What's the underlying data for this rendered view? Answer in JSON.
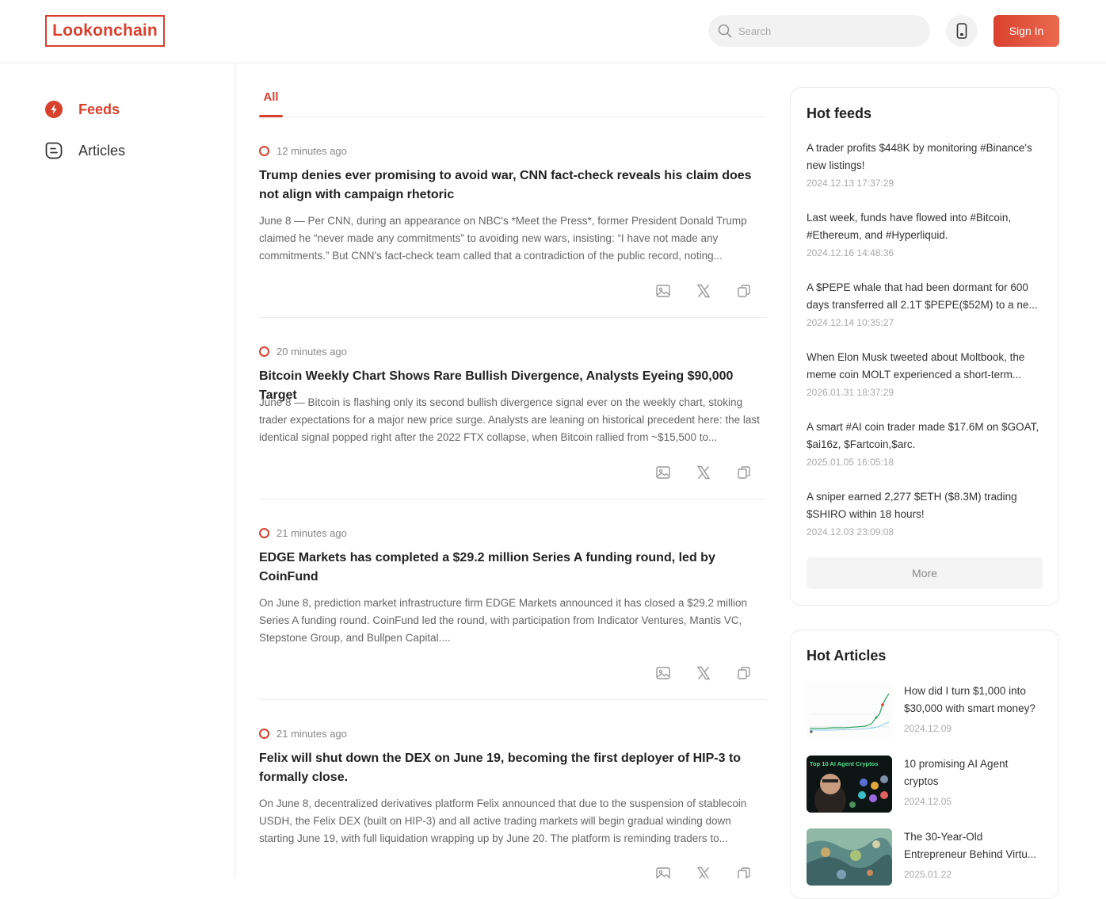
{
  "header": {
    "logo": "Lookonchain",
    "search_placeholder": "Search",
    "sign_in": "Sign In",
    "accent": "#d9412e"
  },
  "sidebar": {
    "items": [
      {
        "label": "Feeds",
        "icon": "lightning-icon",
        "active": true
      },
      {
        "label": "Articles",
        "icon": "article-icon",
        "active": false
      }
    ]
  },
  "main": {
    "tabs": [
      {
        "label": "All",
        "active": true
      }
    ],
    "feeds": [
      {
        "time": "12 minutes ago",
        "title": "Trump denies ever promising to avoid war, CNN fact-check reveals his claim does not align with campaign rhetoric",
        "body": "June 8 — Per CNN, during an appearance on NBC's *Meet the Press*, former President Donald Trump claimed he “never made any commitments” to avoiding new wars, insisting: “I have not made any commitments.” But CNN's fact-check team called that a contradiction of the public record, noting..."
      },
      {
        "time": "20 minutes ago",
        "title": "Bitcoin Weekly Chart Shows Rare Bullish Divergence, Analysts Eyeing $90,000 Target",
        "body": "June 8 — Bitcoin is flashing only its second bullish divergence signal ever on the weekly chart, stoking trader expectations for a major new price surge. Analysts are leaning on historical precedent here: the last identical signal popped right after the 2022 FTX collapse, when Bitcoin rallied from ~$15,500 to..."
      },
      {
        "time": "21 minutes ago",
        "title": "EDGE Markets has completed a $29.2 million Series A funding round, led by CoinFund",
        "body": "On June 8, prediction market infrastructure firm EDGE Markets announced it has closed a $29.2 million Series A funding round. CoinFund led the round, with participation from Indicator Ventures, Mantis VC, Stepstone Group, and Bullpen Capital...."
      },
      {
        "time": "21 minutes ago",
        "title": "Felix will shut down the DEX on June 19, becoming the first deployer of HIP-3 to formally close.",
        "body": "On June 8, decentralized derivatives platform Felix announced that due to the suspension of stablecoin USDH, the Felix DEX (built on HIP-3) and all active trading markets will begin gradual winding down starting June 19, with full liquidation wrapping up by June 20. The platform is reminding traders to..."
      }
    ]
  },
  "hot_feeds": {
    "title": "Hot feeds",
    "more": "More",
    "items": [
      {
        "text": "A trader profits $448K by monitoring #Binance's new listings!",
        "date": "2024.12.13 17:37:29"
      },
      {
        "text": "Last week, funds have flowed into #Bitcoin, #Ethereum, and #Hyperliquid.",
        "date": "2024.12.16 14:48:36"
      },
      {
        "text": "A $PEPE whale that had been dormant for 600 days transferred all 2.1T $PEPE($52M) to a ne...",
        "date": "2024.12.14 10:35:27"
      },
      {
        "text": "When Elon Musk tweeted about Moltbook, the meme coin MOLT experienced a short-term...",
        "date": "2026.01.31 18:37:29"
      },
      {
        "text": "A smart #AI coin trader made $17.6M on $GOAT, $ai16z, $Fartcoin,$arc.",
        "date": "2025.01.05 16:05:18"
      },
      {
        "text": "A sniper earned 2,277 $ETH ($8.3M) trading $SHIRO within 18 hours!",
        "date": "2024.12.03 23:09:08"
      }
    ]
  },
  "hot_articles": {
    "title": "Hot Articles",
    "items": [
      {
        "title": "How did I turn $1,000 into $30,000 with smart money?",
        "date": "2024.12.09"
      },
      {
        "title": "10 promising AI Agent cryptos",
        "date": "2024.12.05",
        "thumb_text": "Top 10 AI Agent Cryptos"
      },
      {
        "title": "The 30-Year-Old Entrepreneur Behind Virtu...",
        "date": "2025.01.22"
      }
    ]
  }
}
